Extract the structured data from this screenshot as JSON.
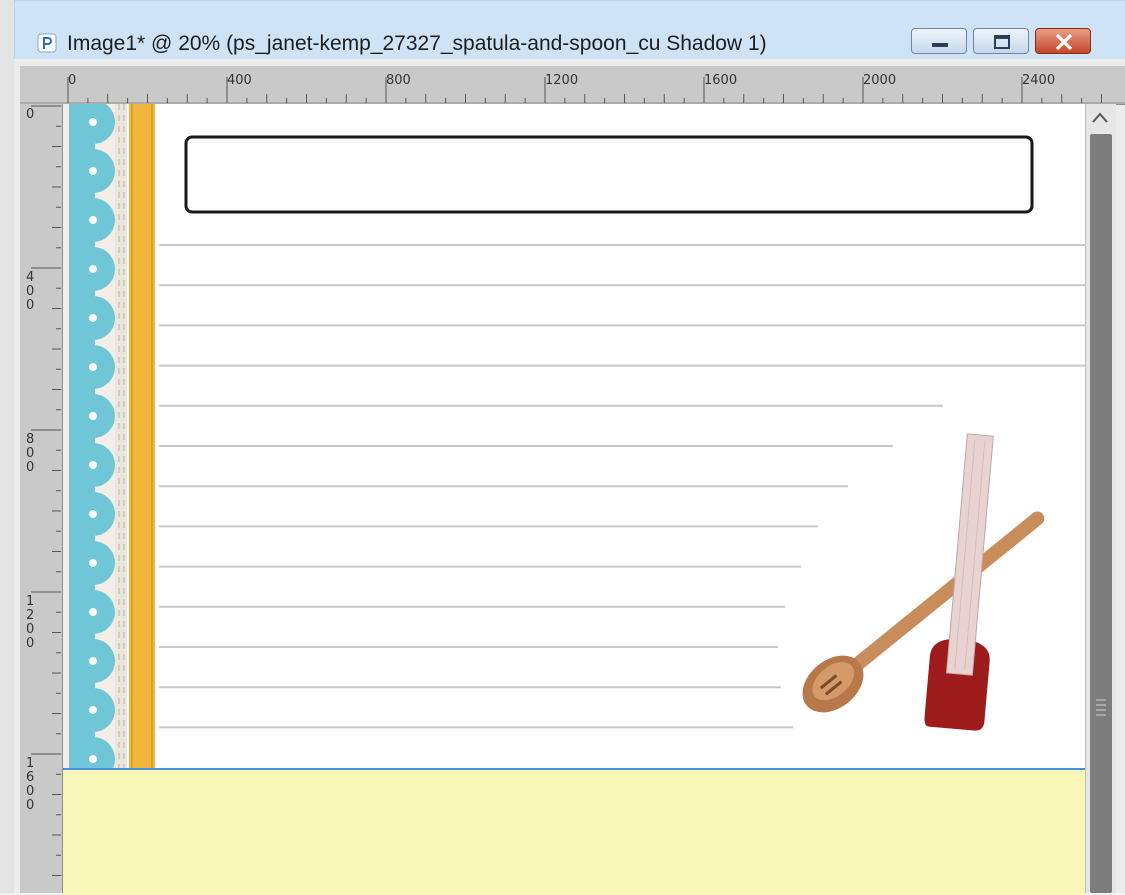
{
  "window": {
    "title": "Image1* @  20% (ps_janet-kemp_27327_spatula-and-spoon_cu Shadow 1)",
    "icon": "psp-document-icon",
    "controls": {
      "minimize": "minimize-icon",
      "maximize": "maximize-icon",
      "close": "close-icon"
    }
  },
  "rulers": {
    "horizontal": {
      "labels": [
        "0",
        "400",
        "800",
        "1200",
        "1600",
        "2000",
        "2400"
      ],
      "units": "pixels"
    },
    "vertical": {
      "labels": [
        "0",
        "400",
        "800",
        "1200",
        "1600"
      ],
      "units": "pixels"
    }
  },
  "canvas": {
    "zoom_percent": 20,
    "layer": "Shadow 1",
    "title_box_text": "",
    "ruled_line_count": 13,
    "border_colors": {
      "scallop": "#6ec6d6",
      "ribbon": "#f3b73b",
      "lines": "#c9c9c9",
      "below_canvas": "#f9f7b8"
    },
    "decoration": "spatula-and-spoon"
  },
  "scrollbar": {
    "up_icon": "scroll-up-arrow-icon",
    "grip_icon": "scroll-grip-icon"
  }
}
